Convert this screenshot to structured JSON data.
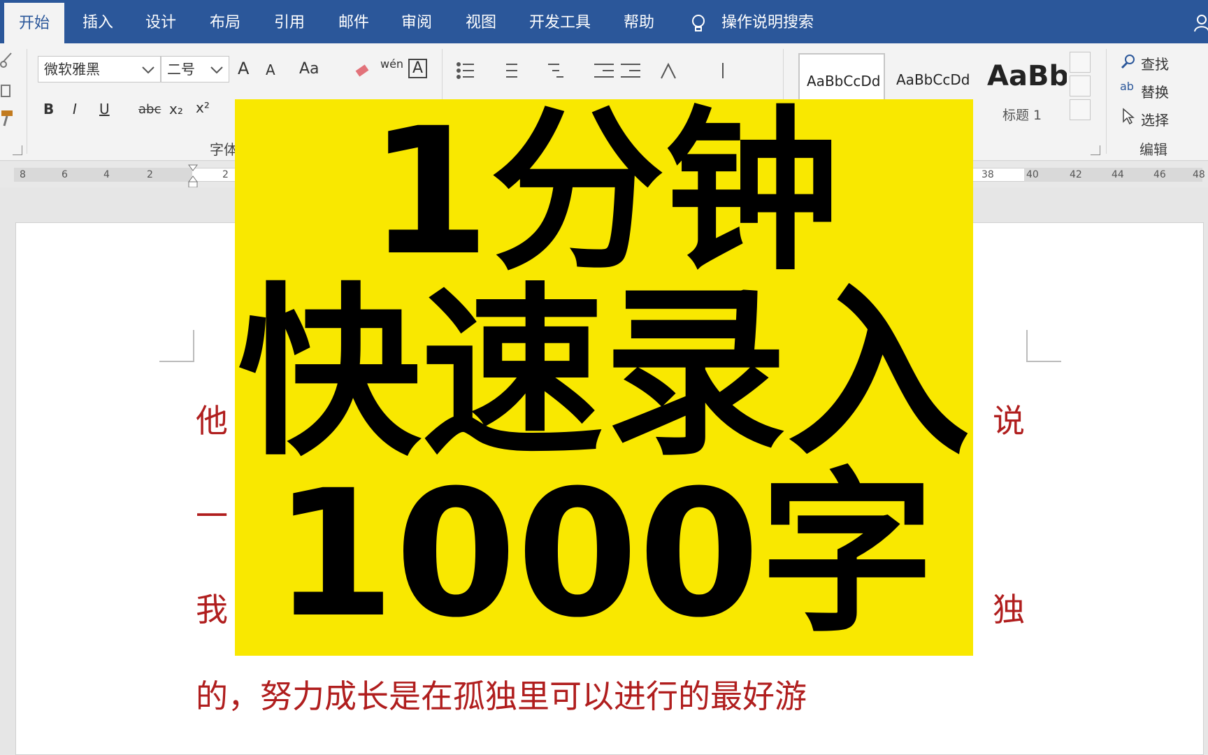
{
  "tabs": [
    "开始",
    "插入",
    "设计",
    "布局",
    "引用",
    "邮件",
    "审阅",
    "视图",
    "开发工具",
    "帮助"
  ],
  "tell_me": "操作说明搜索",
  "font": {
    "name": "微软雅黑",
    "size": "二号",
    "group_label": "字体"
  },
  "format_buttons": {
    "bold": "B",
    "italic": "I",
    "underline": "U",
    "strike": "abc",
    "sub": "x₂",
    "sup": "x²",
    "case": "Aa",
    "phonetic": "wén",
    "border_char": "A",
    "grow": "A",
    "shrink": "A"
  },
  "styles": {
    "normal1": "AaBbCcDd",
    "normal2": "AaBbCcDd",
    "heading_preview": "AaBb",
    "heading_label": "标题 1"
  },
  "editing": {
    "find": "查找",
    "replace": "替换",
    "select": "选择",
    "group_label": "编辑"
  },
  "ruler_left": [
    "8",
    "6",
    "4",
    "2",
    "2"
  ],
  "ruler_right": [
    "38",
    "40",
    "42",
    "44",
    "46",
    "48"
  ],
  "doc_lines": [
    "他",
    "说",
    "一",
    "我",
    "独",
    "的，努力成长是在孤独里可以进行的最好游"
  ],
  "overlay": {
    "line1": "1分钟",
    "line2": "快速录入",
    "line3": "1000字"
  },
  "colors": {
    "ribbon_blue": "#2b579a",
    "doc_text": "#b01e1e",
    "overlay_yellow": "#f9e800"
  }
}
